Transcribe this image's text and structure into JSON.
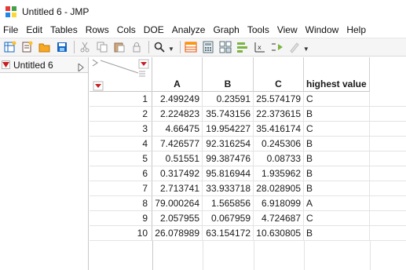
{
  "window": {
    "title": "Untitled 6 - JMP"
  },
  "menu": [
    "File",
    "Edit",
    "Tables",
    "Rows",
    "Cols",
    "DOE",
    "Analyze",
    "Graph",
    "Tools",
    "View",
    "Window",
    "Help"
  ],
  "toolbar": {
    "icons": [
      "new-data-table-icon",
      "new-script-icon",
      "open-icon",
      "save-icon",
      "cut-icon",
      "copy-icon",
      "paste-icon",
      "lock-icon",
      "search-icon",
      "data-table-icon",
      "calculator-icon",
      "grid-icon",
      "bar-chart-icon",
      "formula-icon",
      "arrow-icon",
      "edit-icon"
    ]
  },
  "table_panel": {
    "tab_label": "Untitled 6"
  },
  "table": {
    "columns": [
      "A",
      "B",
      "C",
      "highest value"
    ],
    "rows": [
      {
        "num": "1",
        "A": "2.499249",
        "B": "0.23591",
        "C": "25.574179",
        "highest": "C"
      },
      {
        "num": "2",
        "A": "2.224823",
        "B": "35.743156",
        "C": "22.373615",
        "highest": "B"
      },
      {
        "num": "3",
        "A": "4.66475",
        "B": "19.954227",
        "C": "35.416174",
        "highest": "C"
      },
      {
        "num": "4",
        "A": "7.426577",
        "B": "92.316254",
        "C": "0.245306",
        "highest": "B"
      },
      {
        "num": "5",
        "A": "0.51551",
        "B": "99.387476",
        "C": "0.08733",
        "highest": "B"
      },
      {
        "num": "6",
        "A": "0.317492",
        "B": "95.816944",
        "C": "1.935962",
        "highest": "B"
      },
      {
        "num": "7",
        "A": "2.713741",
        "B": "33.933718",
        "C": "28.028905",
        "highest": "B"
      },
      {
        "num": "8",
        "A": "79.000264",
        "B": "1.565856",
        "C": "6.918099",
        "highest": "A"
      },
      {
        "num": "9",
        "A": "2.057955",
        "B": "0.067959",
        "C": "4.724687",
        "highest": "C"
      },
      {
        "num": "10",
        "A": "26.078989",
        "B": "63.154172",
        "C": "10.630805",
        "highest": "B"
      }
    ]
  },
  "colors": {
    "accent_red": "#c81e1e",
    "header_bg": "#ffffff",
    "grid_line": "#e3e3e3"
  }
}
